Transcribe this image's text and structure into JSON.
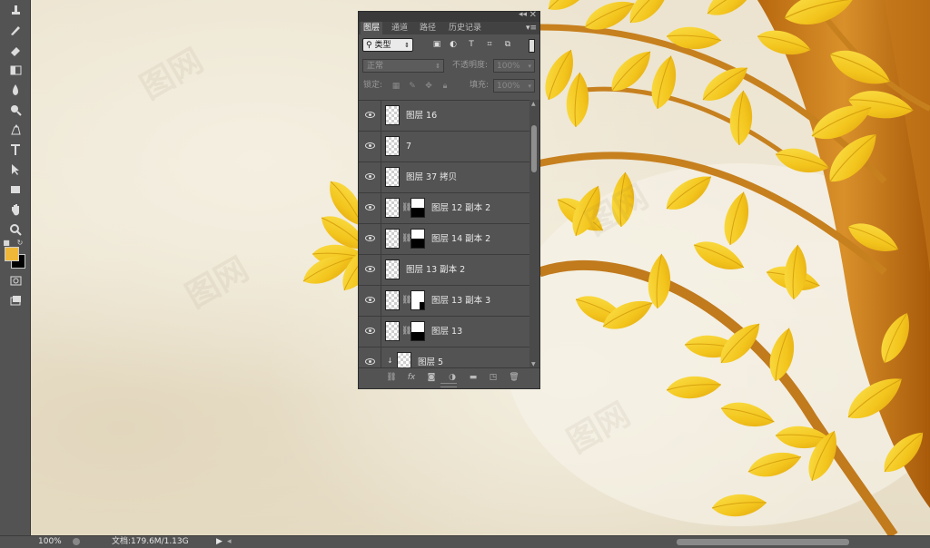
{
  "toolbar": {
    "tools": [
      "stamp-tool",
      "history-brush-tool",
      "eraser-tool",
      "gradient-tool",
      "blur-tool",
      "dodge-tool",
      "pen-tool",
      "type-tool",
      "path-selection-tool",
      "rectangle-tool",
      "hand-tool",
      "zoom-tool"
    ],
    "foreground_color": "#f0b838",
    "background_color": "#000000"
  },
  "panel": {
    "tabs": [
      "图层",
      "通道",
      "路径",
      "历史记录"
    ],
    "active_tab": "图层",
    "filter_kind": "类型",
    "blend_mode": "正常",
    "opacity_label": "不透明度:",
    "opacity_value": "100%",
    "lock_label": "锁定:",
    "fill_label": "填充:",
    "fill_value": "100%"
  },
  "layers": [
    {
      "name": "图层 16",
      "mask": null,
      "linked": false,
      "clipped": false
    },
    {
      "name": "7",
      "mask": null,
      "linked": false,
      "clipped": false
    },
    {
      "name": "图层 37 拷贝",
      "mask": null,
      "linked": false,
      "clipped": false
    },
    {
      "name": "图层 12 副本 2",
      "mask": "bottom-half",
      "linked": true,
      "clipped": false
    },
    {
      "name": "图层 14 副本 2",
      "mask": "bottom-half",
      "linked": true,
      "clipped": false
    },
    {
      "name": "图层 13 副本 2",
      "mask": null,
      "linked": false,
      "clipped": false
    },
    {
      "name": "图层 13 副本 3",
      "mask": "corner",
      "linked": true,
      "clipped": false
    },
    {
      "name": "图层 13",
      "mask": "bottom-third",
      "linked": true,
      "clipped": false
    },
    {
      "name": "图层 5",
      "mask": null,
      "linked": false,
      "clipped": true
    }
  ],
  "status": {
    "zoom": "100%",
    "doc_info": "文档:179.6M/1.13G"
  }
}
